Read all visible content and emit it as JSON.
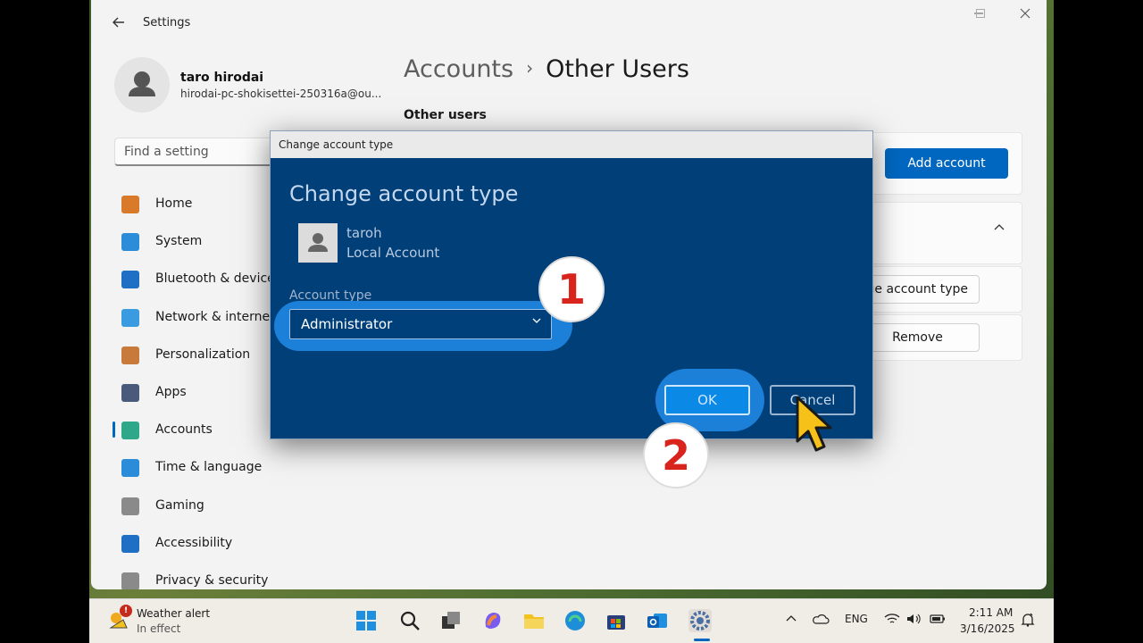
{
  "window": {
    "title": "Settings",
    "back_icon": "back-arrow-icon"
  },
  "profile": {
    "name": "taro hirodai",
    "email": "hirodai-pc-shokisettei-250316a@ou..."
  },
  "search": {
    "placeholder": "Find a setting"
  },
  "nav": {
    "items": [
      {
        "label": "Home",
        "icon": "home-icon",
        "color": "#d97a2b"
      },
      {
        "label": "System",
        "icon": "system-icon",
        "color": "#2b8cd9"
      },
      {
        "label": "Bluetooth & devices",
        "icon": "bluetooth-icon",
        "color": "#1f6fc4"
      },
      {
        "label": "Network & internet",
        "icon": "wifi-icon",
        "color": "#3a9be0"
      },
      {
        "label": "Personalization",
        "icon": "brush-icon",
        "color": "#c87a3a"
      },
      {
        "label": "Apps",
        "icon": "apps-icon",
        "color": "#4a5a7a"
      },
      {
        "label": "Accounts",
        "icon": "accounts-icon",
        "color": "#2fa88a"
      },
      {
        "label": "Time & language",
        "icon": "clock-globe-icon",
        "color": "#2b8cd9"
      },
      {
        "label": "Gaming",
        "icon": "gamepad-icon",
        "color": "#8a8a8a"
      },
      {
        "label": "Accessibility",
        "icon": "accessibility-icon",
        "color": "#1f6fc4"
      },
      {
        "label": "Privacy & security",
        "icon": "shield-icon",
        "color": "#8a8a8a"
      }
    ],
    "selected": "Accounts"
  },
  "content": {
    "breadcrumb_parent": "Accounts",
    "breadcrumb_current": "Other Users",
    "section_heading": "Other users",
    "add_account_label": "Add account",
    "change_type_label": "Change account type",
    "remove_label": "Remove"
  },
  "dialog": {
    "title": "Change account type",
    "heading": "Change account type",
    "username": "taroh",
    "account_kind": "Local Account",
    "field_label": "Account type",
    "selected_value": "Administrator",
    "ok_label": "OK",
    "cancel_label": "Cancel"
  },
  "annotations": {
    "step1": "1",
    "step2": "2",
    "step_color": "#d9231d",
    "highlight_color": "#1c7fd8"
  },
  "taskbar": {
    "weather_title": "Weather alert",
    "weather_sub": "In effect",
    "weather_badge": "!",
    "language": "ENG",
    "time": "2:11 AM",
    "date": "3/16/2025",
    "apps": [
      "start-icon",
      "search-icon",
      "task-view-icon",
      "copilot-icon",
      "file-explorer-icon",
      "edge-icon",
      "store-icon",
      "outlook-icon",
      "settings-gear-icon"
    ]
  }
}
